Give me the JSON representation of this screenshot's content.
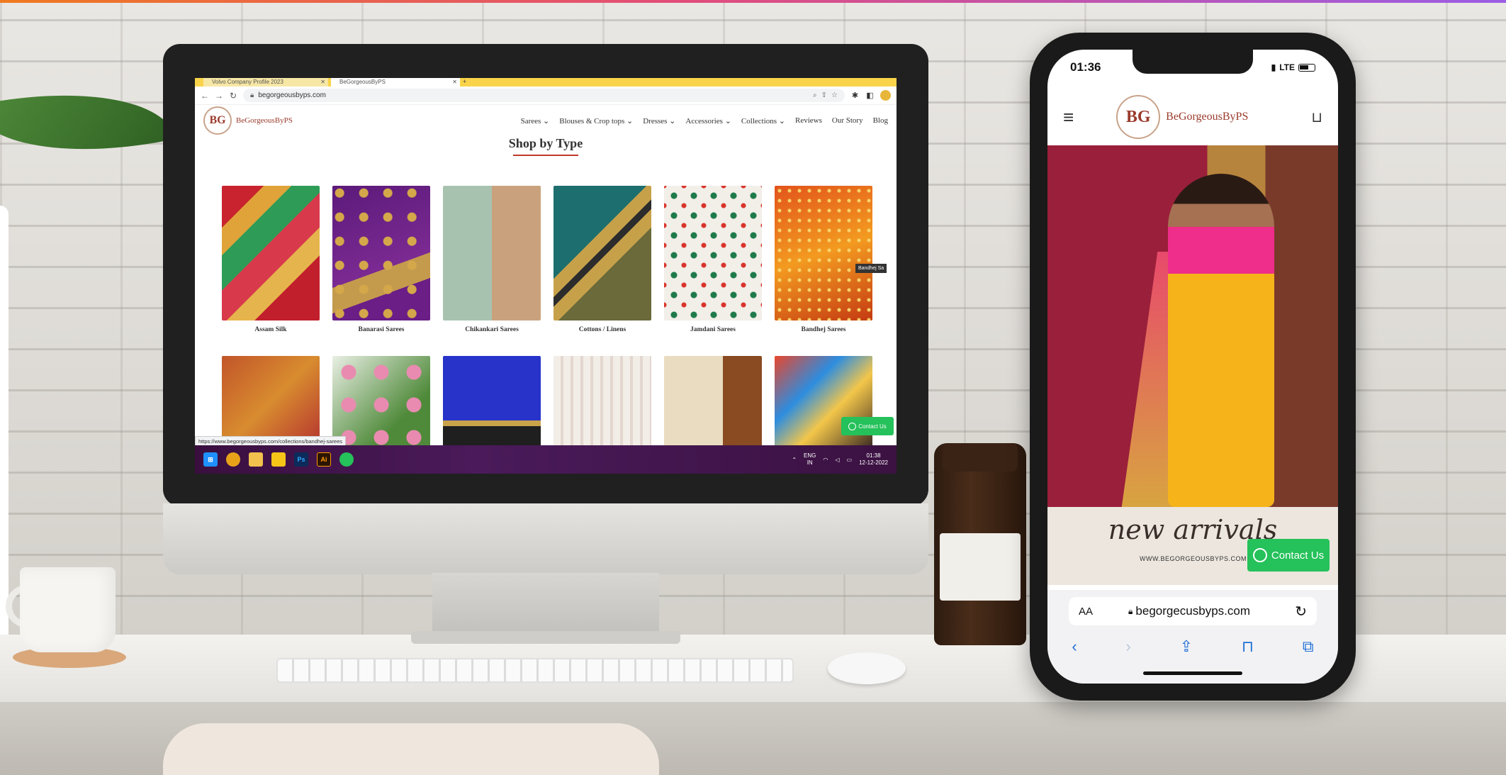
{
  "desktop": {
    "tabs": [
      {
        "label": "Volvo Company Profile 2023"
      },
      {
        "label": "BeGorgeousByPS"
      }
    ],
    "url": "begorgeousbyps.com",
    "site": {
      "logo_mark": "BG",
      "logo_text": "BeGorgeousByPS",
      "nav": [
        "Sarees ⌄",
        "Blouses & Crop tops ⌄",
        "Dresses ⌄",
        "Accessories ⌄",
        "Collections ⌄",
        "Reviews",
        "Our Story",
        "Blog"
      ],
      "section_title": "Shop by Type",
      "categories": [
        "Assam Silk",
        "Banarasi Sarees",
        "Chikankari Sarees",
        "Cottons / Linens",
        "Jamdani Sarees",
        "Bandhej Sarees"
      ],
      "tooltip": "Bandhej Sa",
      "contact_label": "Contact Us",
      "status_url": "https://www.begorgeousbyps.com/collections/bandhej-sarees"
    },
    "taskbar": {
      "apps": [
        "Ps",
        "Ai"
      ],
      "lang_top": "ENG",
      "lang_bottom": "IN",
      "time": "01:38",
      "date": "12-12-2022"
    }
  },
  "phone": {
    "time": "01:36",
    "network": "LTE",
    "logo_mark": "BG",
    "logo_text": "BeGorgeousByPS",
    "banner_script": "new arrivals",
    "banner_site": "WWW.BEGORGEOUSBYPS.COM",
    "contact_label": "Contact Us",
    "text_size_label": "AA",
    "url": "begorgecusbyps.com"
  }
}
